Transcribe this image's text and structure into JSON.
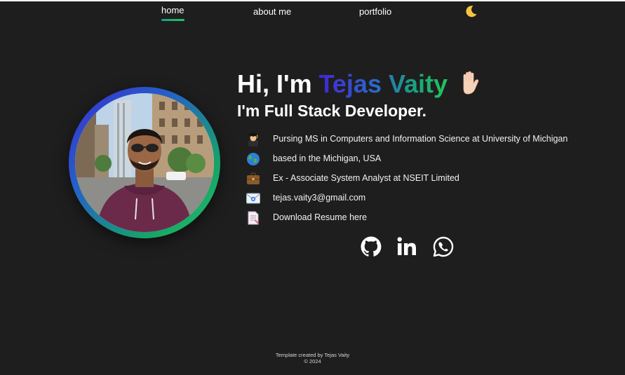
{
  "nav": {
    "items": [
      {
        "label": "home"
      },
      {
        "label": "about me"
      },
      {
        "label": "portfolio"
      }
    ],
    "theme_icon": "moon-icon"
  },
  "hero": {
    "greeting": "Hi, I'm",
    "name": "Tejas Vaity",
    "wave_icon": "waving-hand-icon",
    "subtitle": "I'm Full Stack Developer."
  },
  "profile": {
    "avatar": "profile-photo"
  },
  "info": [
    {
      "icon": "graduate-icon",
      "text": "Pursing MS in Computers and Information Science at University of Michigan"
    },
    {
      "icon": "globe-icon",
      "text": "based in the Michigan, USA"
    },
    {
      "icon": "briefcase-icon",
      "text": "Ex - Associate System Analyst at NSEIT Limited"
    },
    {
      "icon": "email-icon",
      "text": "tejas.vaity3@gmail.com"
    },
    {
      "icon": "document-icon",
      "text": "Download Resume here"
    }
  ],
  "social": [
    {
      "icon": "github-icon"
    },
    {
      "icon": "linkedin-icon"
    },
    {
      "icon": "whatsapp-icon"
    }
  ],
  "footer": {
    "line1": "Template created by Tejas Vaity",
    "line2": "© 2024"
  },
  "colors": {
    "background": "#1e1e1e",
    "accent_start": "#4424d6",
    "accent_end": "#22c55e"
  }
}
